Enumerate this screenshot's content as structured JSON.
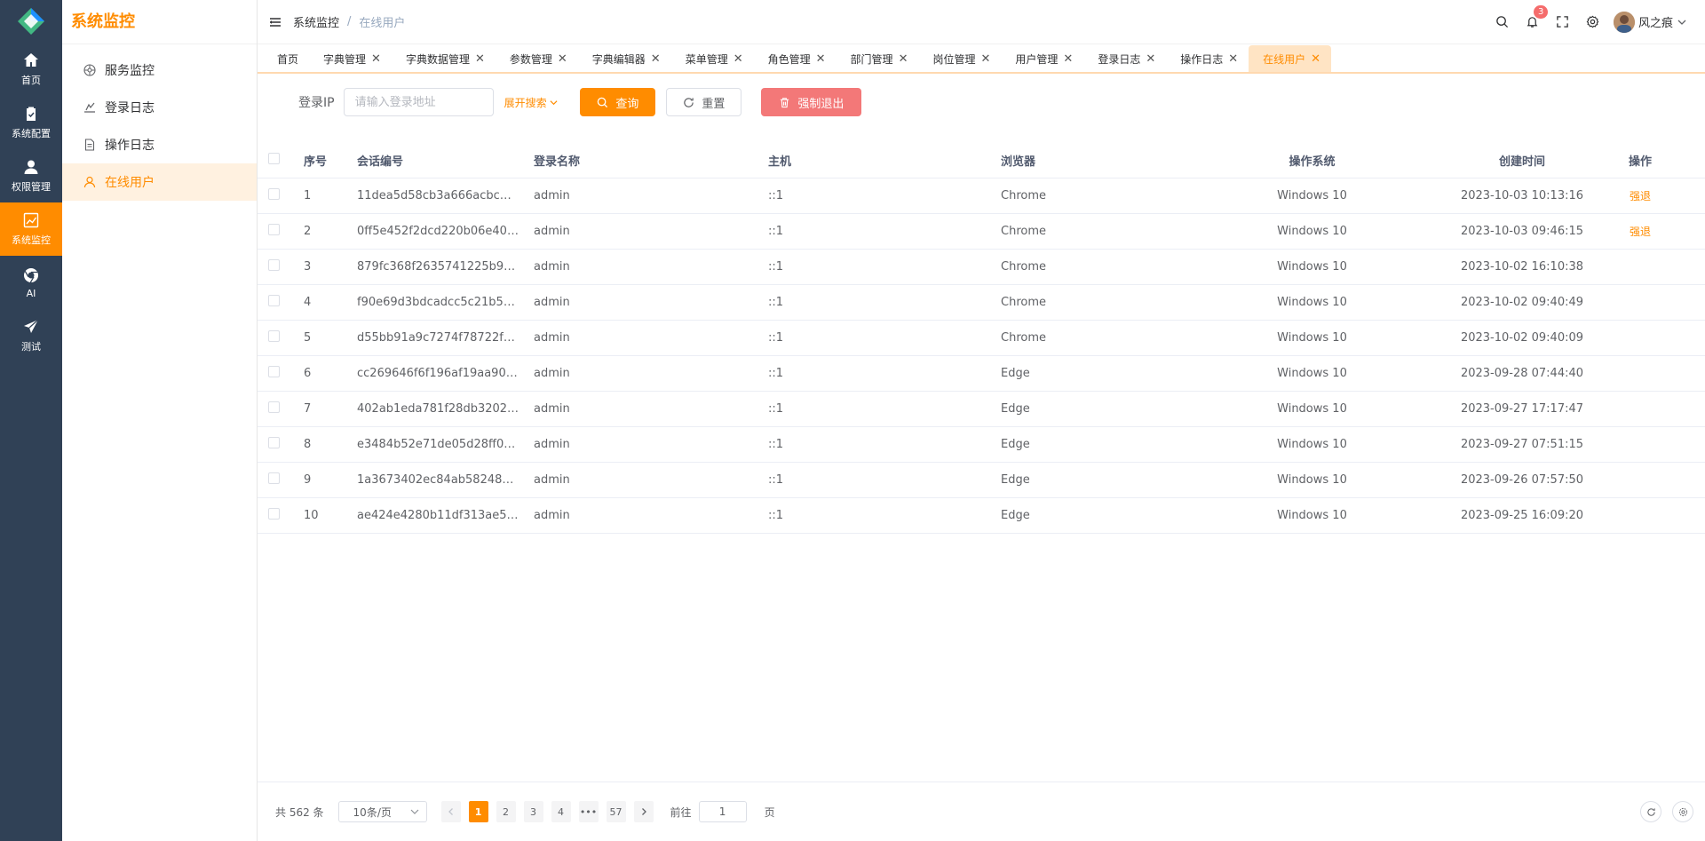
{
  "rail": {
    "items": [
      {
        "label": "首页",
        "icon": "home-icon"
      },
      {
        "label": "系统配置",
        "icon": "clipboard-icon"
      },
      {
        "label": "权限管理",
        "icon": "user-icon"
      },
      {
        "label": "系统监控",
        "icon": "chart-icon"
      },
      {
        "label": "AI",
        "icon": "chrome-icon"
      },
      {
        "label": "测试",
        "icon": "send-icon"
      }
    ],
    "active_index": 3
  },
  "submenu": {
    "title": "系统监控",
    "items": [
      {
        "label": "服务监控",
        "icon": "monitor-icon"
      },
      {
        "label": "登录日志",
        "icon": "login-log-icon"
      },
      {
        "label": "操作日志",
        "icon": "document-icon"
      },
      {
        "label": "在线用户",
        "icon": "user-outline-icon"
      }
    ]
  },
  "header": {
    "breadcrumb_root": "系统监控",
    "breadcrumb_current": "在线用户",
    "notification_count": "3",
    "username": "风之痕"
  },
  "tags": [
    {
      "label": "首页",
      "closable": false
    },
    {
      "label": "字典管理",
      "closable": true
    },
    {
      "label": "字典数据管理",
      "closable": true
    },
    {
      "label": "参数管理",
      "closable": true
    },
    {
      "label": "字典编辑器",
      "closable": true
    },
    {
      "label": "菜单管理",
      "closable": true
    },
    {
      "label": "角色管理",
      "closable": true
    },
    {
      "label": "部门管理",
      "closable": true
    },
    {
      "label": "岗位管理",
      "closable": true
    },
    {
      "label": "用户管理",
      "closable": true
    },
    {
      "label": "登录日志",
      "closable": true
    },
    {
      "label": "操作日志",
      "closable": true
    },
    {
      "label": "在线用户",
      "closable": true,
      "active": true
    }
  ],
  "search": {
    "ip_label": "登录IP",
    "ip_placeholder": "请输入登录地址",
    "expand_label": "展开搜索",
    "query_label": "查询",
    "reset_label": "重置",
    "force_logout_label": "强制退出"
  },
  "table": {
    "headers": {
      "index": "序号",
      "session": "会话编号",
      "login_name": "登录名称",
      "host": "主机",
      "browser": "浏览器",
      "os": "操作系统",
      "created": "创建时间",
      "action": "操作"
    },
    "action_label": "强退",
    "rows": [
      {
        "index": "1",
        "session": "11dea5d58cb3a666acbc…",
        "login_name": "admin",
        "host": "::1",
        "browser": "Chrome",
        "os": "Windows 10",
        "created": "2023-10-03 10:13:16",
        "kick": true
      },
      {
        "index": "2",
        "session": "0ff5e452f2dcd220b06e40…",
        "login_name": "admin",
        "host": "::1",
        "browser": "Chrome",
        "os": "Windows 10",
        "created": "2023-10-03 09:46:15",
        "kick": true
      },
      {
        "index": "3",
        "session": "879fc368f2635741225b9…",
        "login_name": "admin",
        "host": "::1",
        "browser": "Chrome",
        "os": "Windows 10",
        "created": "2023-10-02 16:10:38",
        "kick": false
      },
      {
        "index": "4",
        "session": "f90e69d3bdcadcc5c21b5…",
        "login_name": "admin",
        "host": "::1",
        "browser": "Chrome",
        "os": "Windows 10",
        "created": "2023-10-02 09:40:49",
        "kick": false
      },
      {
        "index": "5",
        "session": "d55bb91a9c7274f78722f…",
        "login_name": "admin",
        "host": "::1",
        "browser": "Chrome",
        "os": "Windows 10",
        "created": "2023-10-02 09:40:09",
        "kick": false
      },
      {
        "index": "6",
        "session": "cc269646f6f196af19aa90…",
        "login_name": "admin",
        "host": "::1",
        "browser": "Edge",
        "os": "Windows 10",
        "created": "2023-09-28 07:44:40",
        "kick": false
      },
      {
        "index": "7",
        "session": "402ab1eda781f28db3202…",
        "login_name": "admin",
        "host": "::1",
        "browser": "Edge",
        "os": "Windows 10",
        "created": "2023-09-27 17:17:47",
        "kick": false
      },
      {
        "index": "8",
        "session": "e3484b52e71de05d28ff0…",
        "login_name": "admin",
        "host": "::1",
        "browser": "Edge",
        "os": "Windows 10",
        "created": "2023-09-27 07:51:15",
        "kick": false
      },
      {
        "index": "9",
        "session": "1a3673402ec84ab58248…",
        "login_name": "admin",
        "host": "::1",
        "browser": "Edge",
        "os": "Windows 10",
        "created": "2023-09-26 07:57:50",
        "kick": false
      },
      {
        "index": "10",
        "session": "ae424e4280b11df313ae5…",
        "login_name": "admin",
        "host": "::1",
        "browser": "Edge",
        "os": "Windows 10",
        "created": "2023-09-25 16:09:20",
        "kick": false
      }
    ]
  },
  "pagination": {
    "total": "共 562 条",
    "page_size": "10条/页",
    "pages": [
      "1",
      "2",
      "3",
      "4",
      "•••",
      "57"
    ],
    "current": "1",
    "goto_label": "前往",
    "goto_value": "1",
    "page_unit": "页"
  },
  "colors": {
    "accent": "#ff8c00",
    "rail_bg": "#304156",
    "danger": "#f37878"
  }
}
